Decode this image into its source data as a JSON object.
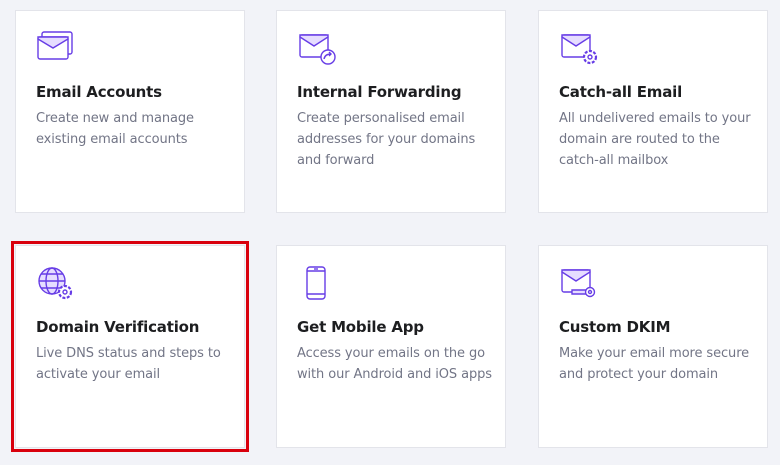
{
  "accent_color": "#673de6",
  "cards": [
    {
      "title": "Email Accounts",
      "description": "Create new and manage existing email accounts",
      "icon": "email-stack-icon"
    },
    {
      "title": "Internal Forwarding",
      "description": "Create personalised email addresses for your domains and forward",
      "icon": "email-forward-icon"
    },
    {
      "title": "Catch-all Email",
      "description": "All undelivered emails to your domain are routed to the catch-all mailbox",
      "icon": "email-gear-icon"
    },
    {
      "title": "Domain Verification",
      "description": "Live DNS status and steps to activate your email",
      "icon": "globe-gear-icon"
    },
    {
      "title": "Get Mobile App",
      "description": "Access your emails on the go with our Android and iOS apps",
      "icon": "mobile-phone-icon"
    },
    {
      "title": "Custom DKIM",
      "description": "Make your email more secure and protect your domain",
      "icon": "email-key-icon"
    }
  ]
}
